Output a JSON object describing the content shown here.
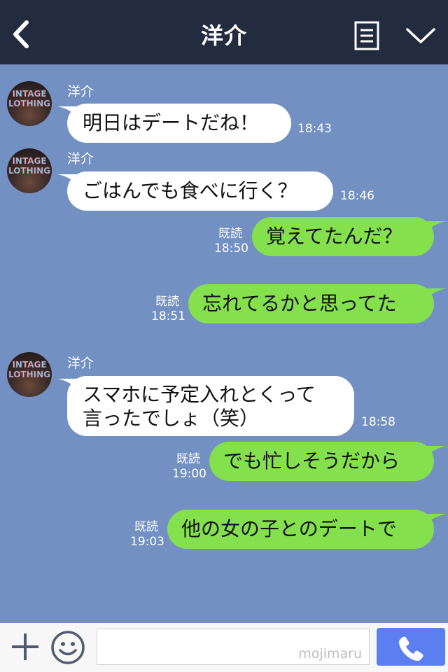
{
  "header": {
    "title": "洋介"
  },
  "messages": [
    {
      "type": "in",
      "sender": "洋介",
      "lines": [
        "明日はデートだね！"
      ],
      "time": "18:43"
    },
    {
      "type": "in",
      "sender": "洋介",
      "lines": [
        "ごはんでも食べに行く？"
      ],
      "time": "18:46"
    },
    {
      "type": "out",
      "lines": [
        "覚えてたんだ？"
      ],
      "read": "既読",
      "time": "18:50"
    },
    {
      "type": "out",
      "lines": [
        "忘れてるかと思ってた"
      ],
      "read": "既読",
      "time": "18:51"
    },
    {
      "type": "in",
      "sender": "洋介",
      "lines": [
        "スマホに予定入れとくって",
        "言ったでしょ（笑）"
      ],
      "time": "18:58"
    },
    {
      "type": "out",
      "lines": [
        "でも忙しそうだから"
      ],
      "read": "既読",
      "time": "19:00"
    },
    {
      "type": "out",
      "lines": [
        "他の女の子とのデートで"
      ],
      "read": "既読",
      "time": "19:03"
    }
  ],
  "avatar": {
    "text_line1": "INTAGE",
    "text_line2": "LOTHING"
  },
  "footer": {
    "watermark": "mojimaru"
  },
  "colors": {
    "header_bg": "#232b3f",
    "chat_bg": "#7290c2",
    "incoming_bubble": "#ffffff",
    "outgoing_bubble": "#85e04d",
    "call_button": "#5b7ff0"
  },
  "icons": {
    "back": "chevron-left-icon",
    "menu": "notes-icon",
    "collapse": "chevron-down-icon",
    "add": "plus-icon",
    "emoji": "smiley-icon",
    "call": "phone-icon"
  }
}
